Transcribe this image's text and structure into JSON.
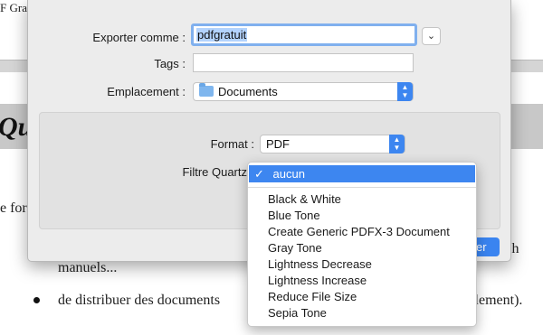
{
  "document": {
    "title_fragment": "F Gra",
    "heading_fragment": "Que",
    "left_fragment": "e for",
    "right_fragment": "s,  sch",
    "line_manuels": "manuels...",
    "bullet_text": "de distribuer des documents",
    "bullet_tail": "eilement)."
  },
  "export_dialog": {
    "name_label": "Exporter comme :",
    "name_value": "pdfgratuit",
    "tags_label": "Tags :",
    "tags_value": "",
    "location_label": "Emplacement :",
    "location_value": "Documents",
    "format_label": "Format :",
    "format_value": "PDF",
    "quartz_label": "Filtre Quartz",
    "save_button_fragment": "er",
    "expand_icon": "chevron-down-icon",
    "folder_icon": "folder-icon",
    "accent_color": "#3d86f0"
  },
  "quartz_menu": {
    "selected": "aucun",
    "check_mark": "✓",
    "items": [
      "Black & White",
      "Blue Tone",
      "Create Generic PDFX-3 Document",
      "Gray Tone",
      "Lightness Decrease",
      "Lightness Increase",
      "Reduce File Size",
      "Sepia Tone"
    ]
  }
}
